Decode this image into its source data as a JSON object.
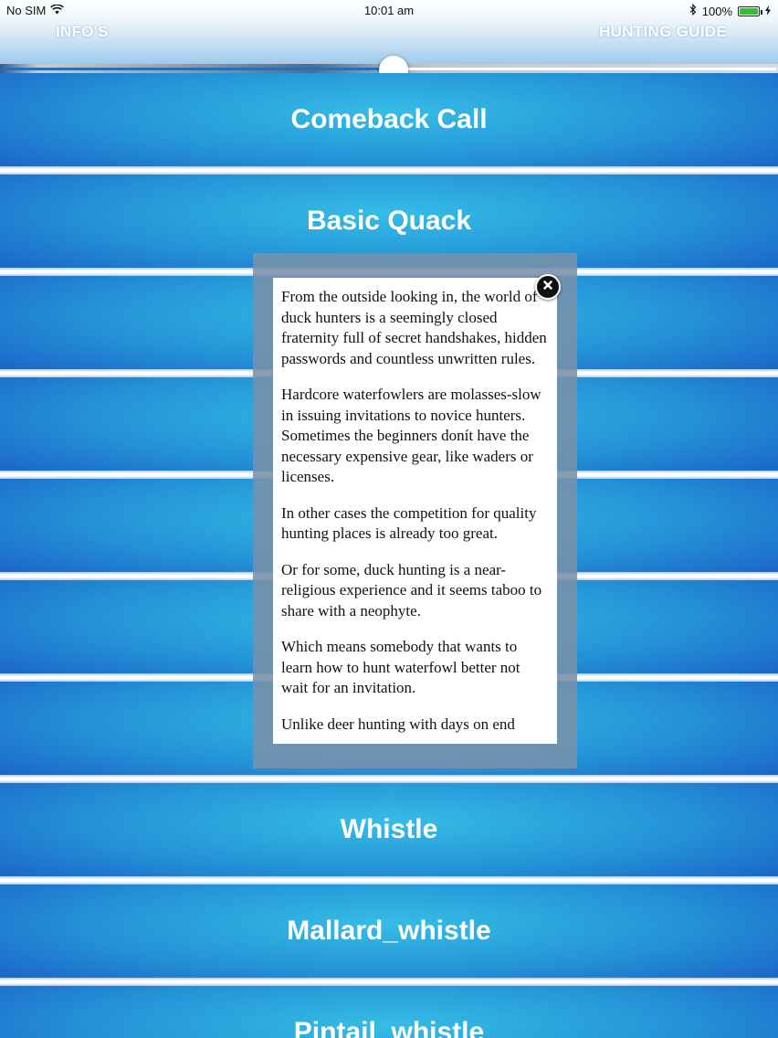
{
  "status_bar": {
    "carrier": "No SIM",
    "time": "10:01 am",
    "battery": "100%",
    "battery_level": 1.0
  },
  "header": {
    "left_button": "INFO'S",
    "right_button": "HUNTING GUIDE"
  },
  "player": {
    "progress": 0.52
  },
  "calls": [
    "Comeback Call",
    "Basic Quack",
    "",
    "",
    "",
    "",
    "",
    "Whistle",
    "Mallard_whistle",
    "Pintail_whistle"
  ],
  "popup": {
    "paragraphs": [
      "From the outside looking in, the world of duck hunters is a seemingly closed fraternity full of secret handshakes, hidden passwords and countless unwritten rules.",
      "Hardcore waterfowlers are molasses-slow in issuing invitations to novice hunters. Sometimes the beginners donít have the necessary expensive gear, like waders or licenses.",
      "In other cases the competition for quality hunting places is already too great.",
      "Or for some, duck hunting is a near-religious experience and it seems taboo to share with a neophyte.",
      "Which means somebody that wants to learn how to hunt waterfowl better not wait for an invitation.",
      "Unlike deer hunting with days on end"
    ]
  },
  "colors": {
    "row_center": "#35bde6",
    "row_edge": "#1a5fc8",
    "popup_frame": "#788faa",
    "battery_green": "#2fc52f"
  }
}
